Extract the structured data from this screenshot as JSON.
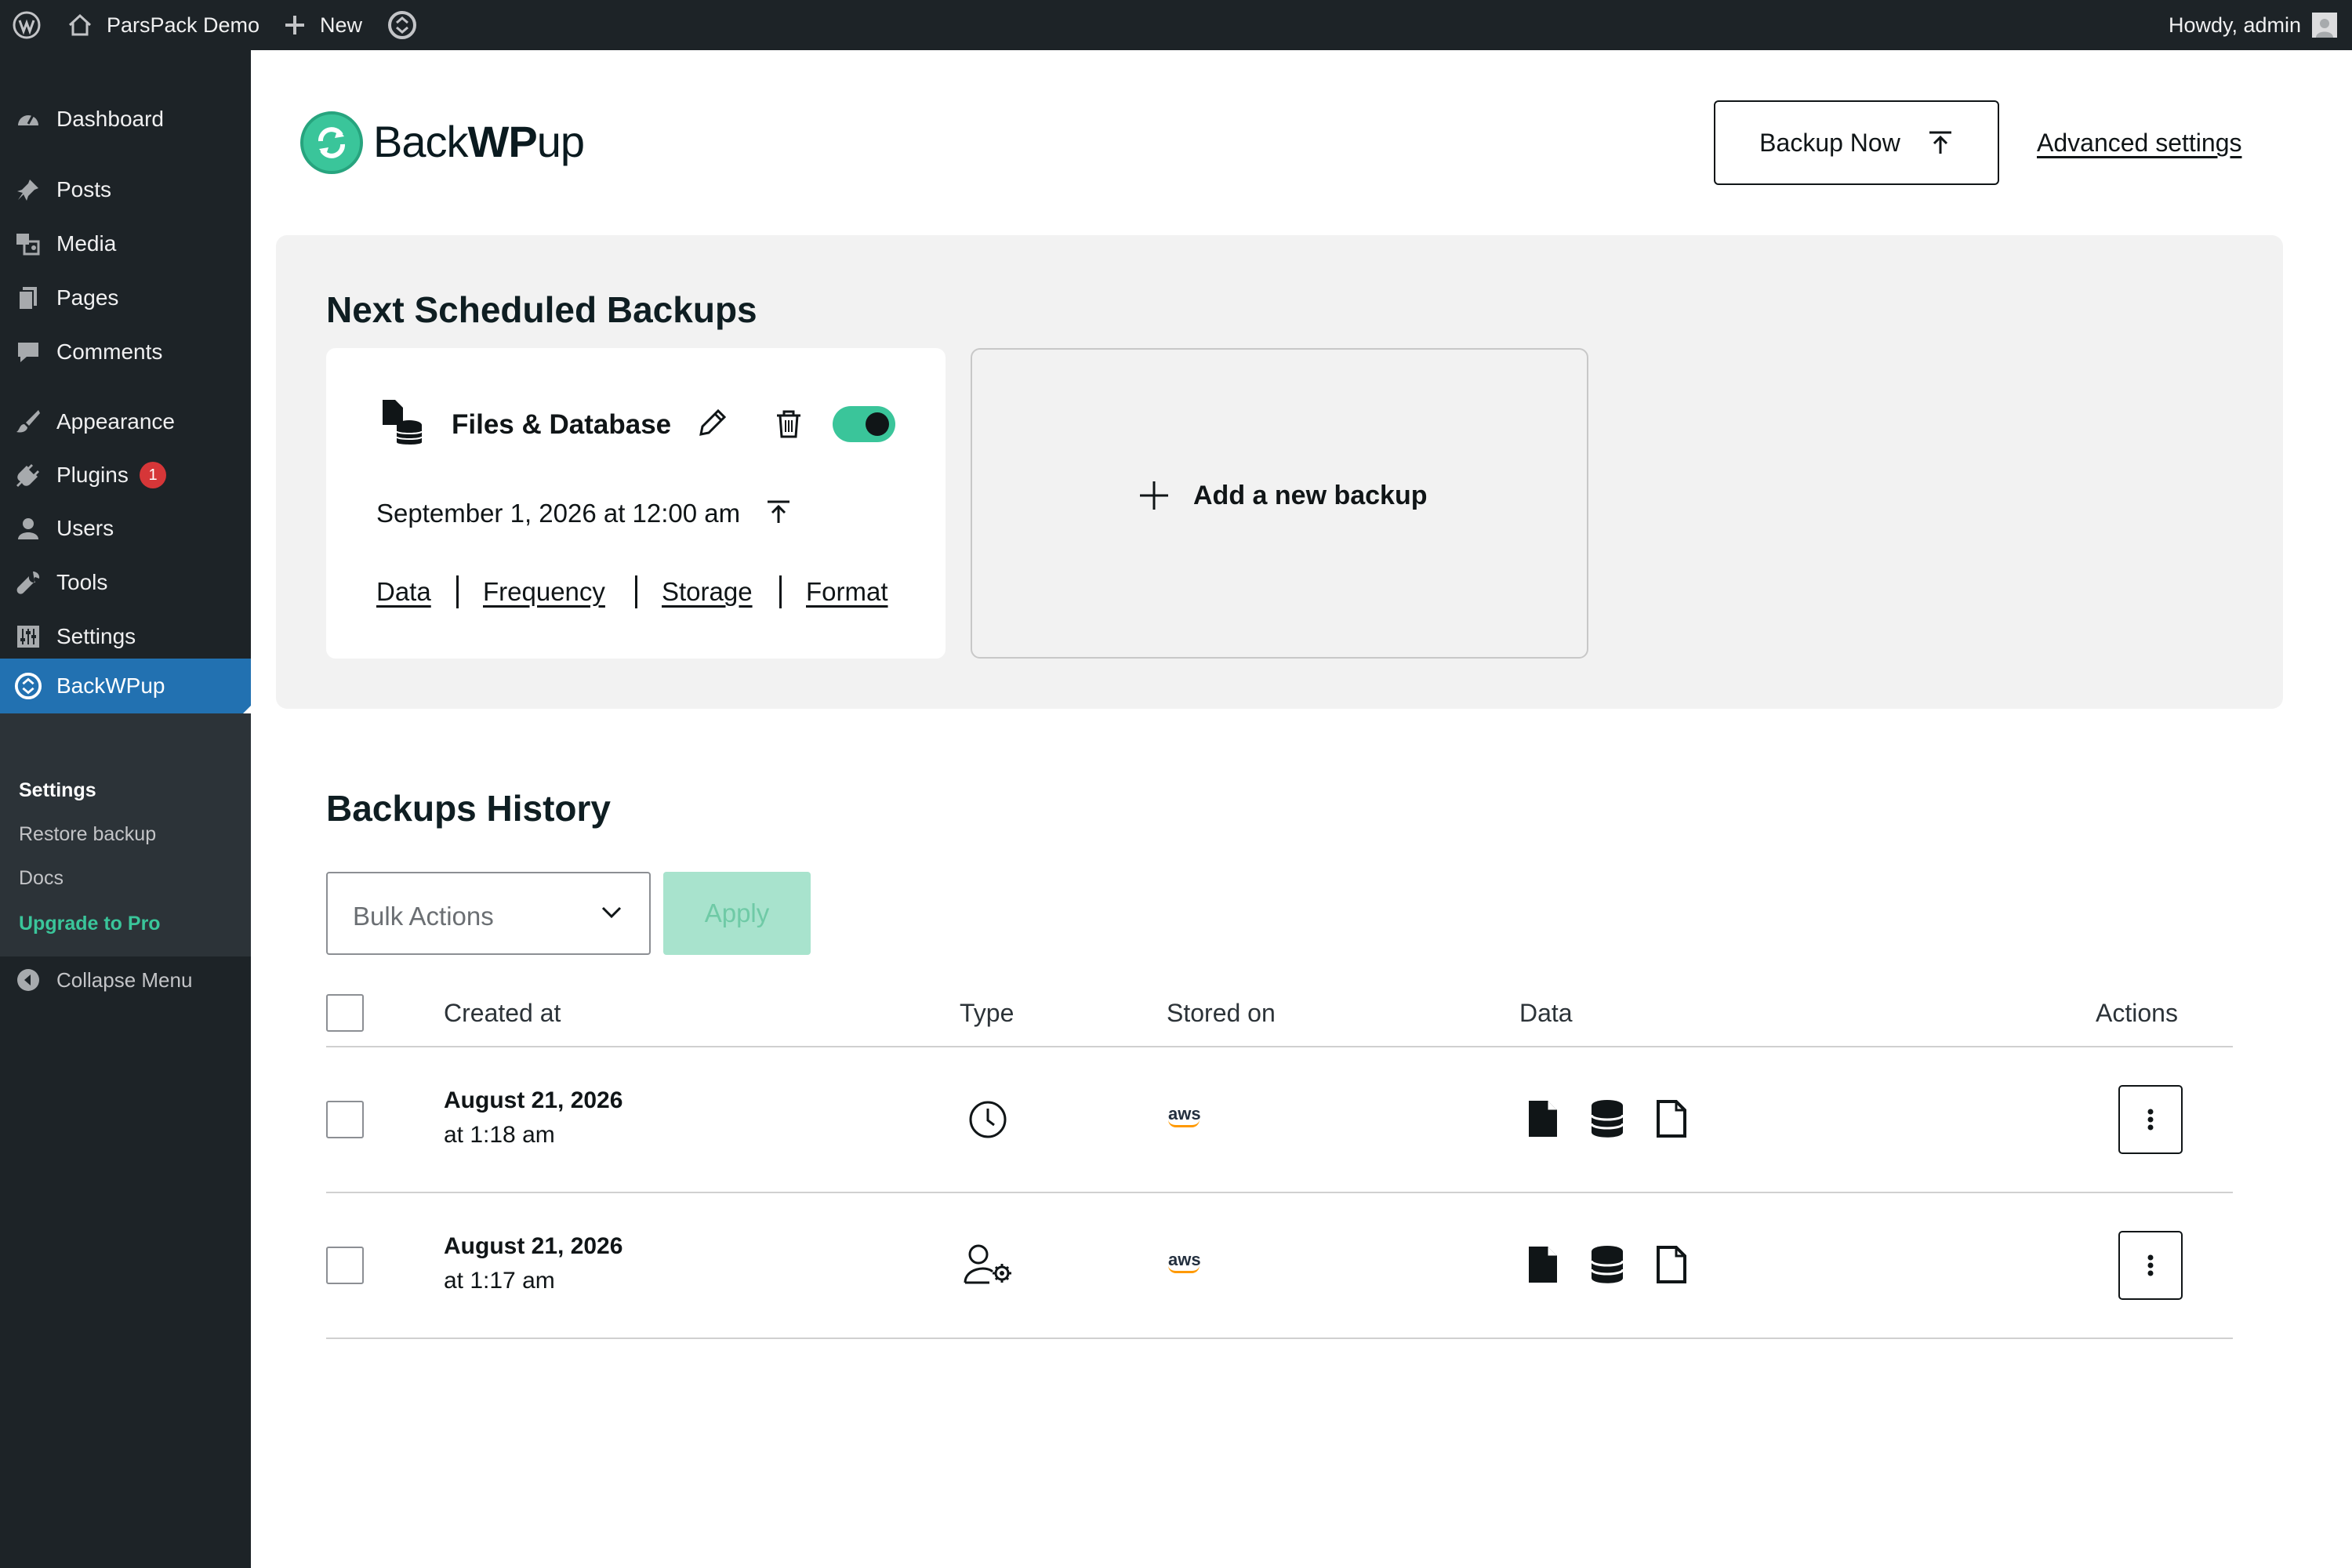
{
  "adminbar": {
    "site_name": "ParsPack Demo",
    "new_label": "New",
    "howdy": "Howdy, admin"
  },
  "sidebar": {
    "items": [
      {
        "label": "Dashboard",
        "icon": "dashboard-icon"
      },
      {
        "label": "Posts",
        "icon": "pin-icon"
      },
      {
        "label": "Media",
        "icon": "media-icon"
      },
      {
        "label": "Pages",
        "icon": "pages-icon"
      },
      {
        "label": "Comments",
        "icon": "comment-icon"
      },
      {
        "label": "Appearance",
        "icon": "brush-icon"
      },
      {
        "label": "Plugins",
        "icon": "plugin-icon",
        "badge": "1"
      },
      {
        "label": "Users",
        "icon": "user-icon"
      },
      {
        "label": "Tools",
        "icon": "wrench-icon"
      },
      {
        "label": "Settings",
        "icon": "settings-icon"
      },
      {
        "label": "BackWPup",
        "icon": "backwpup-icon",
        "active": true
      }
    ],
    "submenu": [
      "Settings",
      "Restore backup",
      "Docs",
      "Upgrade to Pro"
    ],
    "collapse_label": "Collapse Menu"
  },
  "header": {
    "logo_part1": "Back",
    "logo_part2": "WP",
    "logo_part3": "up",
    "backup_now_label": "Backup Now",
    "advanced_settings_label": "Advanced settings"
  },
  "scheduled": {
    "title": "Next Scheduled Backups",
    "card": {
      "name": "Files & Database",
      "date": "September 1, 2026 at 12:00 am",
      "enabled": true,
      "links": [
        "Data",
        "Frequency",
        "Storage",
        "Format"
      ]
    },
    "add_label": "Add a new backup"
  },
  "history": {
    "title": "Backups History",
    "bulk_actions_label": "Bulk Actions",
    "apply_label": "Apply",
    "columns": [
      "Created at",
      "Type",
      "Stored on",
      "Data",
      "Actions"
    ],
    "rows": [
      {
        "date_line1": "August 21, 2026",
        "date_line2": "at 1:18 am",
        "type_icon": "clock-icon",
        "stored_on": "aws",
        "data_icons": [
          "file-icon",
          "database-icon",
          "file-outline-icon"
        ]
      },
      {
        "date_line1": "August 21, 2026",
        "date_line2": "at 1:17 am",
        "type_icon": "user-gear-icon",
        "stored_on": "aws",
        "data_icons": [
          "file-icon",
          "database-icon",
          "file-outline-icon"
        ]
      }
    ]
  },
  "colors": {
    "adminbar_bg": "#1d2327",
    "accent_green": "#3ac59a",
    "active_blue": "#2271b1",
    "badge_red": "#d63638"
  }
}
